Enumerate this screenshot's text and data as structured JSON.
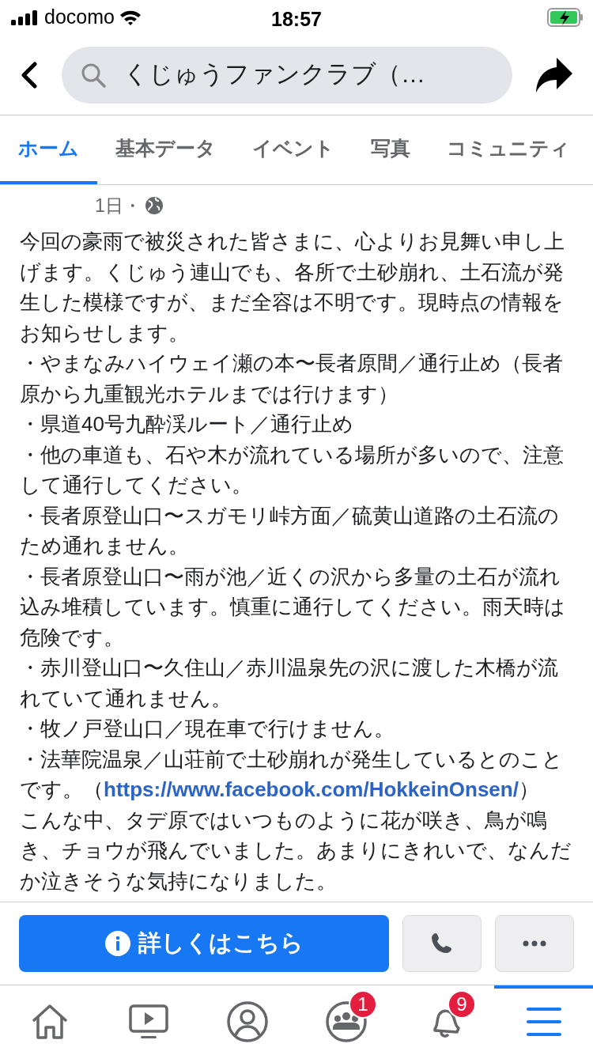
{
  "status_bar": {
    "carrier": "docomo",
    "time": "18:57"
  },
  "header": {
    "search_text": "くじゅうファンクラブ（…"
  },
  "tabs": [
    {
      "label": "ホーム",
      "selected": true
    },
    {
      "label": "基本データ",
      "selected": false
    },
    {
      "label": "イベント",
      "selected": false
    },
    {
      "label": "写真",
      "selected": false
    },
    {
      "label": "コミュニティ",
      "selected": false
    }
  ],
  "post": {
    "time": "1日・",
    "paragraphs": [
      {
        "text": "今回の豪雨で被災された皆さまに、心よりお見舞い申し上げます。くじゅう連山でも、各所で土砂崩れ、土石流が発生した模様ですが、まだ全容は不明です。現時点の情報をお知らせします。"
      },
      {
        "text": "・やまなみハイウェイ瀬の本〜長者原間／通行止め（長者原から九重観光ホテルまでは行けます）"
      },
      {
        "text": "・県道40号九酔渓ルート／通行止め"
      },
      {
        "text": "・他の車道も、石や木が流れている場所が多いので、注意して通行してください。"
      },
      {
        "text": "・長者原登山口〜スガモリ峠方面／硫黄山道路の土石流のため通れません。"
      },
      {
        "text": "・長者原登山口〜雨が池／近くの沢から多量の土石が流れ込み堆積しています。慎重に通行してください。雨天時は危険です。"
      },
      {
        "text": "・赤川登山口〜久住山／赤川温泉先の沢に渡した木橋が流れていて通れません。"
      },
      {
        "text": "・牧ノ戸登山口／現在車で行けません。"
      },
      {
        "text": "・法華院温泉／山荘前で土砂崩れが発生しているとのことです。（",
        "link": "https://www.facebook.com/HokkeinOnsen/",
        "after": "）"
      },
      {
        "text": "こんな中、タデ原ではいつものように花が咲き、鳥が鳴き、チョウが飛んでいました。あまりにきれいで、なんだか泣きそうな気持になりました。"
      }
    ]
  },
  "actions": {
    "primary": "詳しくはこちら"
  },
  "bottom_nav": [
    {
      "kind": "home",
      "selected": false
    },
    {
      "kind": "video",
      "selected": false
    },
    {
      "kind": "profile",
      "selected": false
    },
    {
      "kind": "groups",
      "selected": false,
      "badge": "1"
    },
    {
      "kind": "bell",
      "selected": false,
      "badge": "9"
    },
    {
      "kind": "menu",
      "selected": true
    }
  ]
}
